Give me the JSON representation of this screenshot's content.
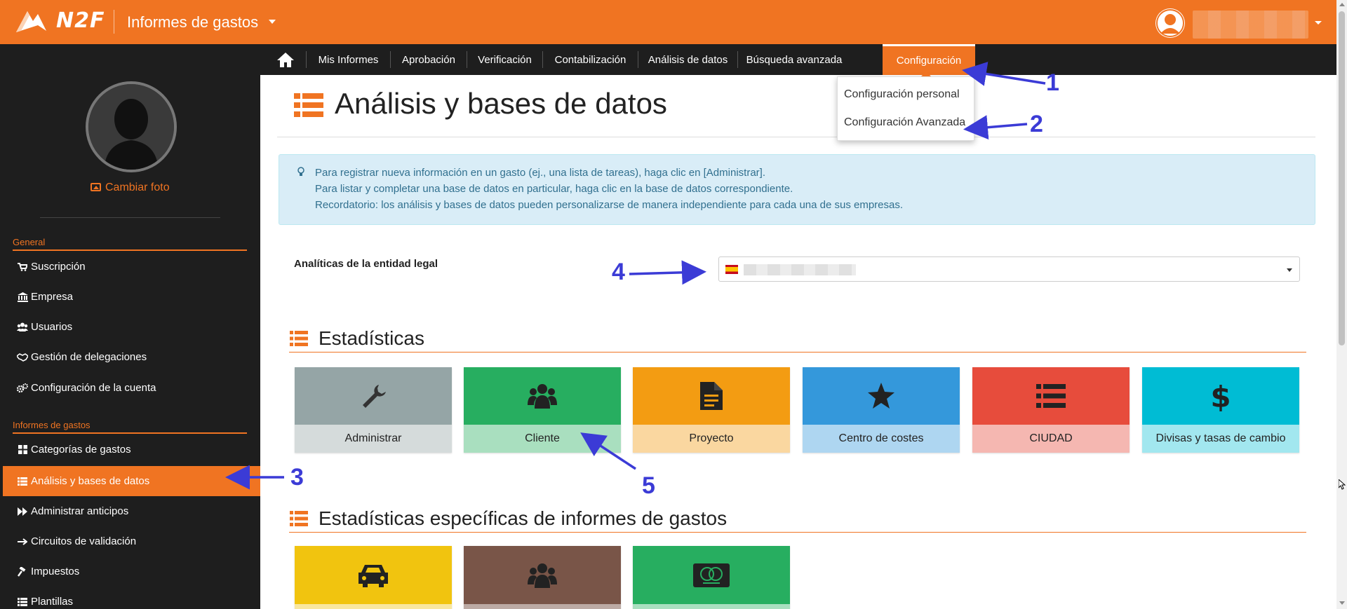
{
  "app": {
    "logo_text": "N2F",
    "title": "Informes de gastos"
  },
  "main_nav": {
    "items": [
      {
        "label": "Mis Informes"
      },
      {
        "label": "Aprobación"
      },
      {
        "label": "Verificación"
      },
      {
        "label": "Contabilización"
      },
      {
        "label": "Análisis de datos"
      },
      {
        "label": "Búsqueda avanzada"
      },
      {
        "label": "Configuración",
        "active": true
      }
    ]
  },
  "config_dropdown": {
    "items": [
      {
        "label": "Configuración personal"
      },
      {
        "label": "Configuración Avanzada"
      }
    ]
  },
  "sidebar": {
    "change_photo": "Cambiar foto",
    "sections": [
      {
        "title": "General",
        "items": [
          {
            "label": "Suscripción",
            "icon": "cart-icon"
          },
          {
            "label": "Empresa",
            "icon": "bank-icon"
          },
          {
            "label": "Usuarios",
            "icon": "users-icon"
          },
          {
            "label": "Gestión de delegaciones",
            "icon": "handshake-icon"
          },
          {
            "label": "Configuración de la cuenta",
            "icon": "gears-icon"
          }
        ]
      },
      {
        "title": "Informes de gastos",
        "items": [
          {
            "label": "Categorías de gastos",
            "icon": "grid-icon"
          },
          {
            "label": "Análisis y bases de datos",
            "icon": "list-icon",
            "active": true
          },
          {
            "label": "Administrar anticipos",
            "icon": "fast-forward-icon"
          },
          {
            "label": "Circuitos de validación",
            "icon": "arrow-right-icon"
          },
          {
            "label": "Impuestos",
            "icon": "gavel-icon"
          },
          {
            "label": "Plantillas",
            "icon": "list-icon"
          }
        ]
      }
    ]
  },
  "page": {
    "title": "Análisis y bases de datos",
    "info_lines": [
      "Para registrar nueva información en un gasto (ej., una lista de tareas), haga clic en [Administrar].",
      "Para listar y completar una base de datos en particular, haga clic en la base de datos correspondiente.",
      "Recordatorio: los análisis y bases de datos pueden personalizarse de manera independiente para cada una de sus empresas."
    ],
    "legal_entity_label": "Analíticas de la entidad legal",
    "stats_title": "Estadísticas",
    "tiles": [
      {
        "label": "Administrar",
        "icon": "wrench-icon",
        "top": "#95a5a6",
        "bottom": "#d5dbdb"
      },
      {
        "label": "Cliente",
        "icon": "users-icon",
        "top": "#27ae60",
        "bottom": "#a9dfbf"
      },
      {
        "label": "Proyecto",
        "icon": "document-icon",
        "top": "#f39c12",
        "bottom": "#fad7a0"
      },
      {
        "label": "Centro de costes",
        "icon": "star-icon",
        "top": "#3498db",
        "bottom": "#aed6f1"
      },
      {
        "label": "CIUDAD",
        "icon": "list-icon",
        "top": "#e74c3c",
        "bottom": "#f5b7b1"
      },
      {
        "label": "Divisas y tasas de cambio",
        "icon": "dollar-icon",
        "top": "#00bcd4",
        "bottom": "#a2e7ef"
      }
    ],
    "specific_title": "Estadísticas específicas de informes de gastos",
    "specific_tiles": [
      {
        "icon": "car-icon",
        "top": "#f1c40f",
        "bottom": "#f9e79f"
      },
      {
        "icon": "users-icon",
        "top": "#795548",
        "bottom": "#bcaaa4"
      },
      {
        "icon": "mastercard-icon",
        "top": "#27ae60",
        "bottom": "#a9dfbf"
      }
    ]
  },
  "annotations": [
    "1",
    "2",
    "3",
    "4",
    "5"
  ],
  "colors": {
    "brand": "#f07422",
    "dark": "#1e1e1e",
    "annotation": "#3b3bd6"
  }
}
